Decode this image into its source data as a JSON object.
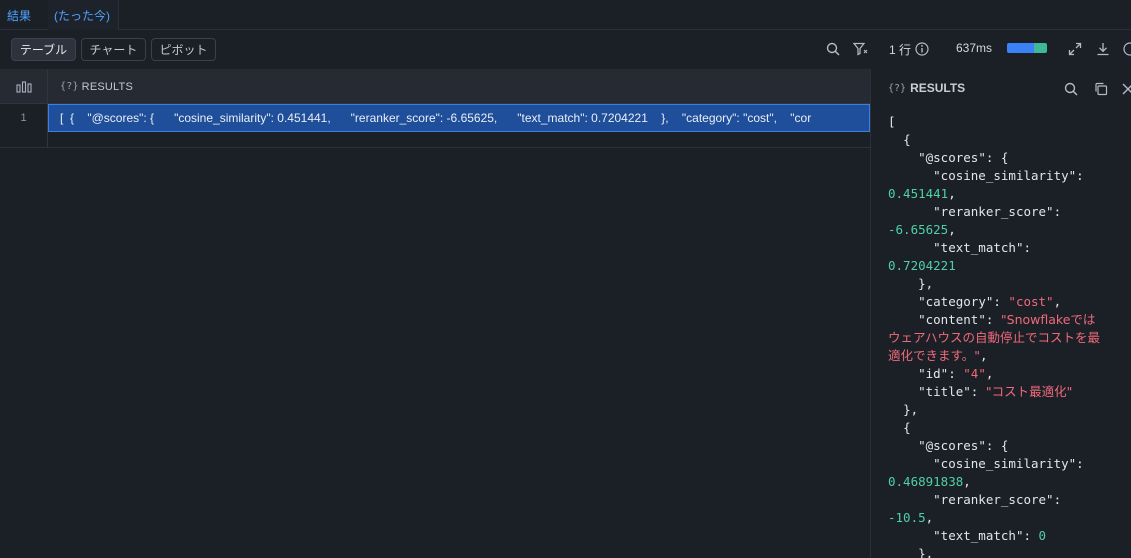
{
  "tabs": {
    "results_label": "結果",
    "time_label": "(たった今)"
  },
  "toolbar": {
    "view_buttons": [
      "テーブル",
      "チャート",
      "ピボット"
    ],
    "active_view": "テーブル",
    "row_count": "1 行",
    "duration": "637ms",
    "icons": [
      "search-icon",
      "filter-icon",
      "info-icon",
      "expand-icon",
      "download-icon",
      "help-icon"
    ]
  },
  "grid": {
    "column_header": "RESULTS",
    "column_type_glyph": "{?}",
    "rows": [
      {
        "num": "1",
        "value": "[  {    \"@scores\": {      \"cosine_similarity\": 0.451441,      \"reranker_score\": -6.65625,      \"text_match\": 0.7204221    },    \"category\": \"cost\",    \"cor"
      }
    ]
  },
  "panel": {
    "title": "RESULTS",
    "type_glyph": "{?}",
    "json_lines": [
      {
        "parts": [
          [
            "k",
            "["
          ]
        ]
      },
      {
        "parts": [
          [
            "k",
            "  {"
          ]
        ]
      },
      {
        "parts": [
          [
            "k",
            "    \"@scores\": {"
          ]
        ]
      },
      {
        "parts": [
          [
            "k",
            "      \"cosine_similarity\":"
          ]
        ]
      },
      {
        "parts": [
          [
            "n",
            "0.451441"
          ],
          [
            "k",
            ","
          ]
        ]
      },
      {
        "parts": [
          [
            "k",
            "      \"reranker_score\":"
          ]
        ]
      },
      {
        "parts": [
          [
            "n",
            "-6.65625"
          ],
          [
            "k",
            ","
          ]
        ]
      },
      {
        "parts": [
          [
            "k",
            "      \"text_match\":"
          ]
        ]
      },
      {
        "parts": [
          [
            "n",
            "0.7204221"
          ]
        ]
      },
      {
        "parts": [
          [
            "k",
            "    },"
          ]
        ]
      },
      {
        "parts": [
          [
            "k",
            "    \"category\": "
          ],
          [
            "s",
            "\"cost\""
          ],
          [
            "k",
            ","
          ]
        ]
      },
      {
        "parts": [
          [
            "k",
            "    \"content\": "
          ],
          [
            "s",
            "\"Snowflakeでは"
          ]
        ]
      },
      {
        "parts": [
          [
            "s",
            "ウェアハウスの自動停止でコストを最"
          ]
        ]
      },
      {
        "parts": [
          [
            "s",
            "適化できます。\""
          ],
          [
            "k",
            ","
          ]
        ]
      },
      {
        "parts": [
          [
            "k",
            "    \"id\": "
          ],
          [
            "s",
            "\"4\""
          ],
          [
            "k",
            ","
          ]
        ]
      },
      {
        "parts": [
          [
            "k",
            "    \"title\": "
          ],
          [
            "s",
            "\"コスト最適化\""
          ]
        ]
      },
      {
        "parts": [
          [
            "k",
            "  },"
          ]
        ]
      },
      {
        "parts": [
          [
            "k",
            "  {"
          ]
        ]
      },
      {
        "parts": [
          [
            "k",
            "    \"@scores\": {"
          ]
        ]
      },
      {
        "parts": [
          [
            "k",
            "      \"cosine_similarity\":"
          ]
        ]
      },
      {
        "parts": [
          [
            "n",
            "0.46891838"
          ],
          [
            "k",
            ","
          ]
        ]
      },
      {
        "parts": [
          [
            "k",
            "      \"reranker_score\":"
          ]
        ]
      },
      {
        "parts": [
          [
            "n",
            "-10.5"
          ],
          [
            "k",
            ","
          ]
        ]
      },
      {
        "parts": [
          [
            "k",
            "      \"text_match\": "
          ],
          [
            "n",
            "0"
          ]
        ]
      },
      {
        "parts": [
          [
            "k",
            "    },"
          ]
        ]
      }
    ]
  }
}
